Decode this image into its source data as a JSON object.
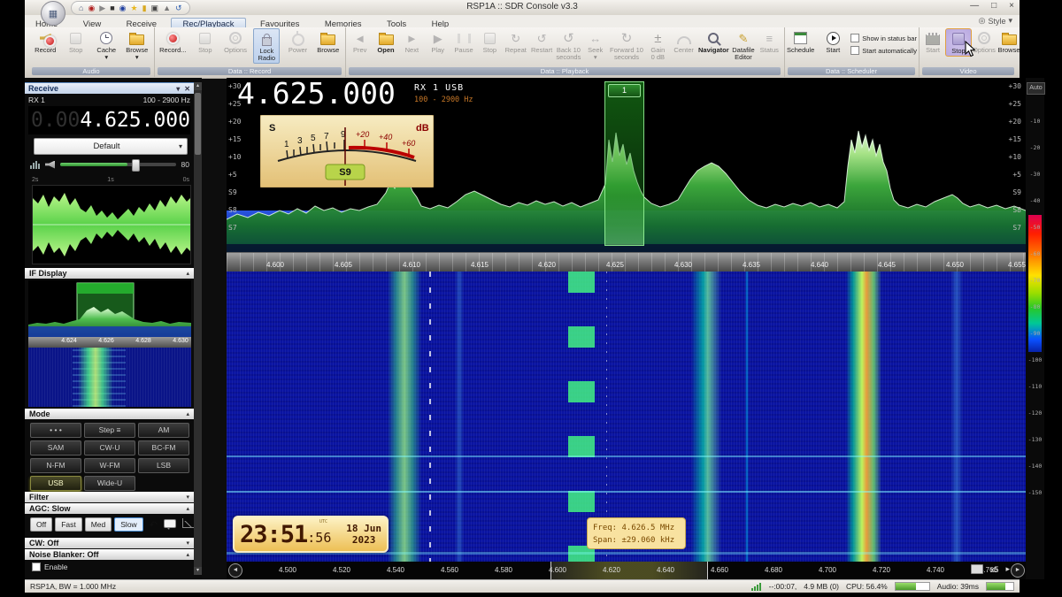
{
  "window": {
    "title": "RSP1A :: SDR Console v3.3"
  },
  "icons": {
    "app_grid": "▦",
    "home": "⌂",
    "target": "◉",
    "play": "▶",
    "stop_sq": "■",
    "orb_dot": "●",
    "star": "★",
    "lock_bar": "▮",
    "camera": "▣",
    "tower": "▲",
    "undo": "↺",
    "minimize": "—",
    "maximize": "□",
    "close": "×",
    "style_circle": "◎",
    "chevron_down": "▾",
    "chevron_up": "▴",
    "panel_close": "✕",
    "repeat": "↻",
    "restart": "↺",
    "seek": "↔",
    "gain": "±",
    "pencil": "✎",
    "list": "≡",
    "prev": "◄",
    "next": "►",
    "small_right": "▸",
    "nav_left": "◄",
    "nav_right": "►",
    "agc_undo": "↶"
  },
  "ribbon": {
    "style_label": "Style",
    "tabs": [
      {
        "label": "Home"
      },
      {
        "label": "View"
      },
      {
        "label": "Receive"
      },
      {
        "label": "Rec/Playback"
      },
      {
        "label": "Favourites"
      },
      {
        "label": "Memories"
      },
      {
        "label": "Tools"
      },
      {
        "label": "Help"
      }
    ],
    "groups": [
      {
        "label": "Audio",
        "buttons": [
          {
            "label": "Record"
          },
          {
            "label": "Stop"
          },
          {
            "label": "Cache"
          },
          {
            "label": "Browse"
          }
        ]
      },
      {
        "label": "Data :: Record",
        "buttons": [
          {
            "label": "Record..."
          },
          {
            "label": "Stop"
          },
          {
            "label": "Options"
          },
          {
            "label": "Lock",
            "sub": "Radio"
          },
          {
            "label": "Power"
          },
          {
            "label": "Browse"
          }
        ]
      },
      {
        "label": "Data :: Playback",
        "buttons": [
          {
            "label": "Prev"
          },
          {
            "label": "Open"
          },
          {
            "label": "Next"
          },
          {
            "label": "Play"
          },
          {
            "label": "Pause"
          },
          {
            "label": "Stop"
          },
          {
            "label": "Repeat"
          },
          {
            "label": "Restart"
          },
          {
            "label": "Back 10",
            "sub": "seconds"
          },
          {
            "label": "Seek"
          },
          {
            "label": "Forward 10",
            "sub": "seconds"
          },
          {
            "label": "Gain",
            "sub": "0 dB"
          },
          {
            "label": "Center"
          },
          {
            "label": "Navigator"
          },
          {
            "label": "Datafile",
            "sub": "Editor"
          },
          {
            "label": "Status"
          }
        ]
      },
      {
        "label": "Data :: Scheduler",
        "buttons": [
          {
            "label": "Schedule"
          },
          {
            "label": "Start"
          }
        ],
        "checkboxes": [
          {
            "label": "Show in status bar"
          },
          {
            "label": "Start automatically"
          }
        ]
      },
      {
        "label": "Video",
        "buttons": [
          {
            "label": "Start"
          },
          {
            "label": "Stop"
          },
          {
            "label": "Options"
          },
          {
            "label": "Browse"
          }
        ]
      }
    ]
  },
  "receive_panel": {
    "title": "Receive",
    "rx_label": "RX 1",
    "range": "100 - 2900 Hz",
    "freq_dim": "0.00",
    "freq": "4.625.000",
    "profile": "Default",
    "volume": "80",
    "scope_times": [
      {
        "t": "2s"
      },
      {
        "t": "1s"
      },
      {
        "t": "0s"
      }
    ],
    "if_display": {
      "title": "IF Display",
      "ticks": [
        {
          "f": "4.624"
        },
        {
          "f": "4.626"
        },
        {
          "f": "4.628"
        },
        {
          "f": "4.630"
        }
      ]
    },
    "mode": {
      "title": "Mode",
      "buttons": [
        {
          "label": "• • •"
        },
        {
          "label": "Step ≡"
        },
        {
          "label": "AM"
        },
        {
          "label": "SAM"
        },
        {
          "label": "CW-U"
        },
        {
          "label": "BC-FM"
        },
        {
          "label": "N-FM"
        },
        {
          "label": "W-FM"
        },
        {
          "label": "LSB"
        },
        {
          "label": "USB"
        },
        {
          "label": "Wide-U"
        }
      ]
    },
    "filter_label": "Filter",
    "agc": {
      "label": "AGC: Slow",
      "buttons": [
        {
          "label": "Off"
        },
        {
          "label": "Fast"
        },
        {
          "label": "Med"
        },
        {
          "label": "Slow"
        }
      ]
    },
    "cw_label": "CW: Off",
    "nb_label": "Noise Blanker: Off",
    "nb_enable": "Enable"
  },
  "main": {
    "freq": "4.625.000",
    "rx_line": "RX 1  USB",
    "range": "100 - 2900 Hz",
    "marker_label": "1",
    "smeter": {
      "s": "S",
      "db": "dB",
      "value": "S9",
      "black_ticks": [
        {
          "t": "1"
        },
        {
          "t": "3"
        },
        {
          "t": "5"
        },
        {
          "t": "7"
        },
        {
          "t": "9"
        }
      ],
      "red_ticks": [
        {
          "t": "+20"
        },
        {
          "t": "+40"
        },
        {
          "t": "+60"
        }
      ]
    },
    "db_labels": [
      {
        "t": "+30"
      },
      {
        "t": "+25"
      },
      {
        "t": "+20"
      },
      {
        "t": "+15"
      },
      {
        "t": "+10"
      },
      {
        "t": "+5"
      },
      {
        "t": "S9"
      },
      {
        "t": "S8"
      },
      {
        "t": "S7"
      }
    ],
    "spectrum_ticks": [
      {
        "f": "4.600"
      },
      {
        "f": "4.605"
      },
      {
        "f": "4.610"
      },
      {
        "f": "4.615"
      },
      {
        "f": "4.620"
      },
      {
        "f": "4.625"
      },
      {
        "f": "4.630"
      },
      {
        "f": "4.635"
      },
      {
        "f": "4.640"
      },
      {
        "f": "4.645"
      },
      {
        "f": "4.650"
      },
      {
        "f": "4.655"
      }
    ],
    "clock": {
      "hm": "23:51",
      "sec": ":56",
      "utc": "UTC",
      "date1": "18 Jun",
      "date2": "2023"
    },
    "tooltip": {
      "freq": "Freq: 4.626.5 MHz",
      "span": "Span: ±29.060 kHz"
    },
    "nav_ticks": [
      {
        "f": "4.500"
      },
      {
        "f": "4.520"
      },
      {
        "f": "4.540"
      },
      {
        "f": "4.560"
      },
      {
        "f": "4.580"
      },
      {
        "f": "4.600"
      },
      {
        "f": "4.620"
      },
      {
        "f": "4.640"
      },
      {
        "f": "4.660"
      },
      {
        "f": "4.680"
      },
      {
        "f": "4.700"
      },
      {
        "f": "4.720"
      },
      {
        "f": "4.740"
      },
      {
        "f": "4.760"
      }
    ],
    "zoom_label": "x5"
  },
  "right_scale": {
    "auto_label": "Auto",
    "labels": [
      {
        "t": "-10"
      },
      {
        "t": "-20"
      },
      {
        "t": "-30"
      },
      {
        "t": "-40"
      },
      {
        "t": "-50"
      },
      {
        "t": "-60"
      },
      {
        "t": "-70"
      },
      {
        "t": "-80"
      },
      {
        "t": "-90"
      },
      {
        "t": "-100"
      },
      {
        "t": "-110"
      },
      {
        "t": "-120"
      },
      {
        "t": "-130"
      },
      {
        "t": "-140"
      },
      {
        "t": "-150"
      }
    ]
  },
  "statusbar": {
    "left": "RSP1A, BW = 1.000 MHz",
    "time": "--:00:07,",
    "mem": "4.9 MB (0)",
    "cpu": "CPU: 56.4%",
    "audio": "Audio: 39ms"
  },
  "colors": {
    "accent_blue": "#4a90d9",
    "meter_face": "#f2dfa8",
    "badge_green": "#b8d44a",
    "waterfall_blue": "#0a14a2",
    "spectrum_green": "#3fae3f"
  }
}
